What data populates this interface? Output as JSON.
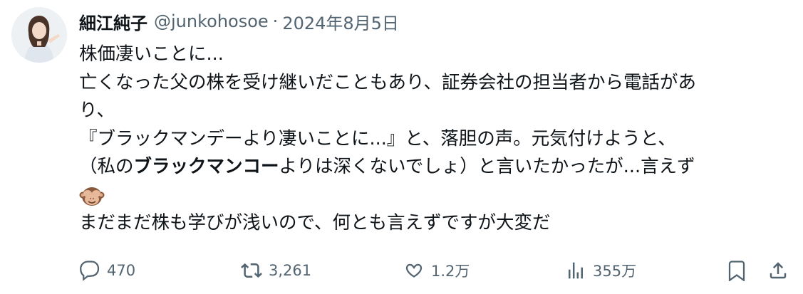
{
  "author": {
    "display_name": "細江純子",
    "handle": "@junkohosoe",
    "separator": "·",
    "date": "2024年8月5日"
  },
  "tweet": {
    "line1": "株価凄いことに...",
    "line2": "亡くなった父の株を受け継いだこともあり、証券会社の担当者から電話があ",
    "line3": "り、",
    "line4": "『ブラックマンデーより凄いことに...』と、落胆の声。元気付けようと、",
    "line5_pre": "（私の",
    "line5_bold": "ブラックマンコー",
    "line5_post": "よりは深くないでしょ）と言いたかったが...言えず",
    "emoji": "see-no-evil-monkey",
    "line7": "まだまだ株も学びが浅いので、何とも言えずですが大変だ"
  },
  "actions": {
    "reply_count": "470",
    "retweet_count": "3,261",
    "like_count": "1.2万",
    "view_count": "355万",
    "icons": [
      "reply-icon",
      "retweet-icon",
      "like-icon",
      "views-icon",
      "bookmark-icon",
      "share-icon"
    ]
  },
  "colors": {
    "text": "#0f1419",
    "secondary": "#536471",
    "background": "#ffffff"
  }
}
